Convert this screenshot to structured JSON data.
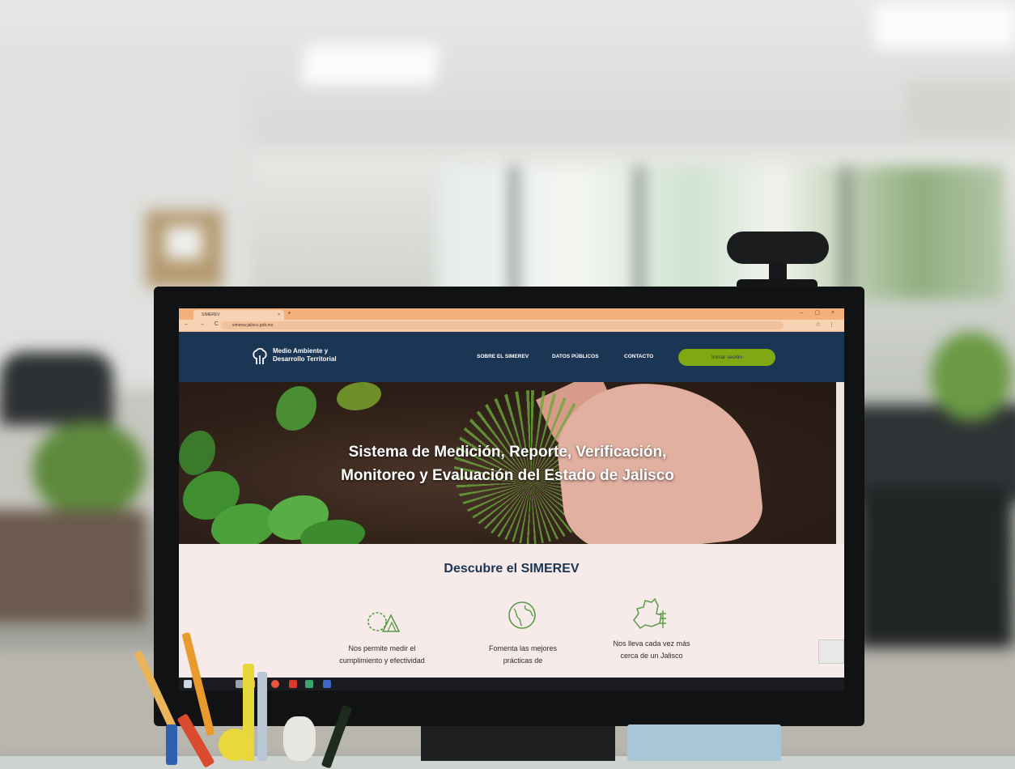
{
  "browser": {
    "tab_title": "SIMEREV",
    "tab_close": "×",
    "new_tab": "+",
    "window_controls": "– ▢ ×",
    "nav_buttons": "← → C",
    "url": "simerev.jalisco.gob.mx",
    "toolbar_icons": "☆ ⋮"
  },
  "header": {
    "logo_line1": "Medio Ambiente y",
    "logo_line2": "Desarrollo Territorial",
    "menu": [
      "SOBRE EL SIMEREV",
      "DATOS PÚBLICOS",
      "CONTACTO"
    ],
    "login": "Iniciar sesión"
  },
  "hero": {
    "title_line1": "Sistema de Medición, Reporte, Verificación,",
    "title_line2": "Monitoreo y Evaluación del Estado de Jalisco"
  },
  "discover": {
    "title": "Descubre el SIMEREV",
    "features": [
      {
        "icon": "gear-leaf-icon",
        "line1": "Nos permite medir el",
        "line2": "cumplimiento y efectividad"
      },
      {
        "icon": "globe-icon",
        "line1": "Fomenta las mejores",
        "line2": "prácticas de"
      },
      {
        "icon": "jalisco-map-icon",
        "line1": "Nos lleva cada vez más",
        "line2": "cerca de un Jalisco"
      }
    ]
  },
  "colors": {
    "header_bg": "#1b3554",
    "login_button": "#7fa813",
    "discover_bg": "#f6ebe8",
    "icon_green": "#5a9a4a",
    "browser_orange": "#f3b07b"
  }
}
